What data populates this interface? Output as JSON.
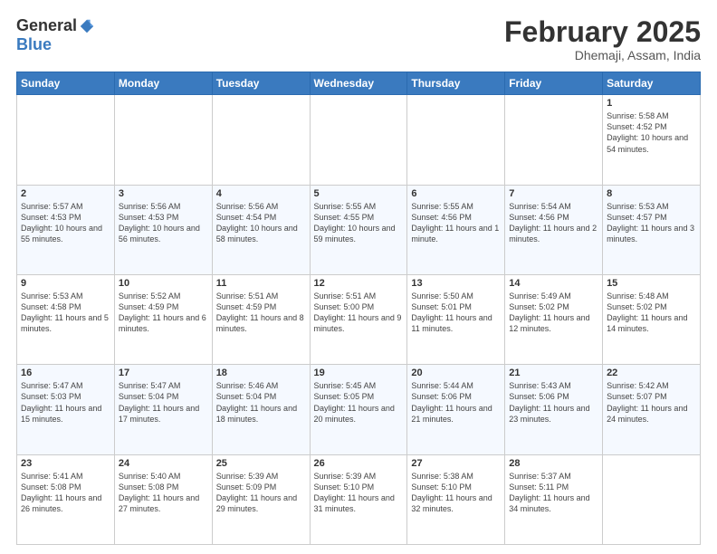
{
  "logo": {
    "general": "General",
    "blue": "Blue"
  },
  "header": {
    "month": "February 2025",
    "location": "Dhemaji, Assam, India"
  },
  "days_of_week": [
    "Sunday",
    "Monday",
    "Tuesday",
    "Wednesday",
    "Thursday",
    "Friday",
    "Saturday"
  ],
  "weeks": [
    [
      {
        "day": "",
        "info": ""
      },
      {
        "day": "",
        "info": ""
      },
      {
        "day": "",
        "info": ""
      },
      {
        "day": "",
        "info": ""
      },
      {
        "day": "",
        "info": ""
      },
      {
        "day": "",
        "info": ""
      },
      {
        "day": "1",
        "info": "Sunrise: 5:58 AM\nSunset: 4:52 PM\nDaylight: 10 hours and 54 minutes."
      }
    ],
    [
      {
        "day": "2",
        "info": "Sunrise: 5:57 AM\nSunset: 4:53 PM\nDaylight: 10 hours and 55 minutes."
      },
      {
        "day": "3",
        "info": "Sunrise: 5:56 AM\nSunset: 4:53 PM\nDaylight: 10 hours and 56 minutes."
      },
      {
        "day": "4",
        "info": "Sunrise: 5:56 AM\nSunset: 4:54 PM\nDaylight: 10 hours and 58 minutes."
      },
      {
        "day": "5",
        "info": "Sunrise: 5:55 AM\nSunset: 4:55 PM\nDaylight: 10 hours and 59 minutes."
      },
      {
        "day": "6",
        "info": "Sunrise: 5:55 AM\nSunset: 4:56 PM\nDaylight: 11 hours and 1 minute."
      },
      {
        "day": "7",
        "info": "Sunrise: 5:54 AM\nSunset: 4:56 PM\nDaylight: 11 hours and 2 minutes."
      },
      {
        "day": "8",
        "info": "Sunrise: 5:53 AM\nSunset: 4:57 PM\nDaylight: 11 hours and 3 minutes."
      }
    ],
    [
      {
        "day": "9",
        "info": "Sunrise: 5:53 AM\nSunset: 4:58 PM\nDaylight: 11 hours and 5 minutes."
      },
      {
        "day": "10",
        "info": "Sunrise: 5:52 AM\nSunset: 4:59 PM\nDaylight: 11 hours and 6 minutes."
      },
      {
        "day": "11",
        "info": "Sunrise: 5:51 AM\nSunset: 4:59 PM\nDaylight: 11 hours and 8 minutes."
      },
      {
        "day": "12",
        "info": "Sunrise: 5:51 AM\nSunset: 5:00 PM\nDaylight: 11 hours and 9 minutes."
      },
      {
        "day": "13",
        "info": "Sunrise: 5:50 AM\nSunset: 5:01 PM\nDaylight: 11 hours and 11 minutes."
      },
      {
        "day": "14",
        "info": "Sunrise: 5:49 AM\nSunset: 5:02 PM\nDaylight: 11 hours and 12 minutes."
      },
      {
        "day": "15",
        "info": "Sunrise: 5:48 AM\nSunset: 5:02 PM\nDaylight: 11 hours and 14 minutes."
      }
    ],
    [
      {
        "day": "16",
        "info": "Sunrise: 5:47 AM\nSunset: 5:03 PM\nDaylight: 11 hours and 15 minutes."
      },
      {
        "day": "17",
        "info": "Sunrise: 5:47 AM\nSunset: 5:04 PM\nDaylight: 11 hours and 17 minutes."
      },
      {
        "day": "18",
        "info": "Sunrise: 5:46 AM\nSunset: 5:04 PM\nDaylight: 11 hours and 18 minutes."
      },
      {
        "day": "19",
        "info": "Sunrise: 5:45 AM\nSunset: 5:05 PM\nDaylight: 11 hours and 20 minutes."
      },
      {
        "day": "20",
        "info": "Sunrise: 5:44 AM\nSunset: 5:06 PM\nDaylight: 11 hours and 21 minutes."
      },
      {
        "day": "21",
        "info": "Sunrise: 5:43 AM\nSunset: 5:06 PM\nDaylight: 11 hours and 23 minutes."
      },
      {
        "day": "22",
        "info": "Sunrise: 5:42 AM\nSunset: 5:07 PM\nDaylight: 11 hours and 24 minutes."
      }
    ],
    [
      {
        "day": "23",
        "info": "Sunrise: 5:41 AM\nSunset: 5:08 PM\nDaylight: 11 hours and 26 minutes."
      },
      {
        "day": "24",
        "info": "Sunrise: 5:40 AM\nSunset: 5:08 PM\nDaylight: 11 hours and 27 minutes."
      },
      {
        "day": "25",
        "info": "Sunrise: 5:39 AM\nSunset: 5:09 PM\nDaylight: 11 hours and 29 minutes."
      },
      {
        "day": "26",
        "info": "Sunrise: 5:39 AM\nSunset: 5:10 PM\nDaylight: 11 hours and 31 minutes."
      },
      {
        "day": "27",
        "info": "Sunrise: 5:38 AM\nSunset: 5:10 PM\nDaylight: 11 hours and 32 minutes."
      },
      {
        "day": "28",
        "info": "Sunrise: 5:37 AM\nSunset: 5:11 PM\nDaylight: 11 hours and 34 minutes."
      },
      {
        "day": "",
        "info": ""
      }
    ]
  ]
}
